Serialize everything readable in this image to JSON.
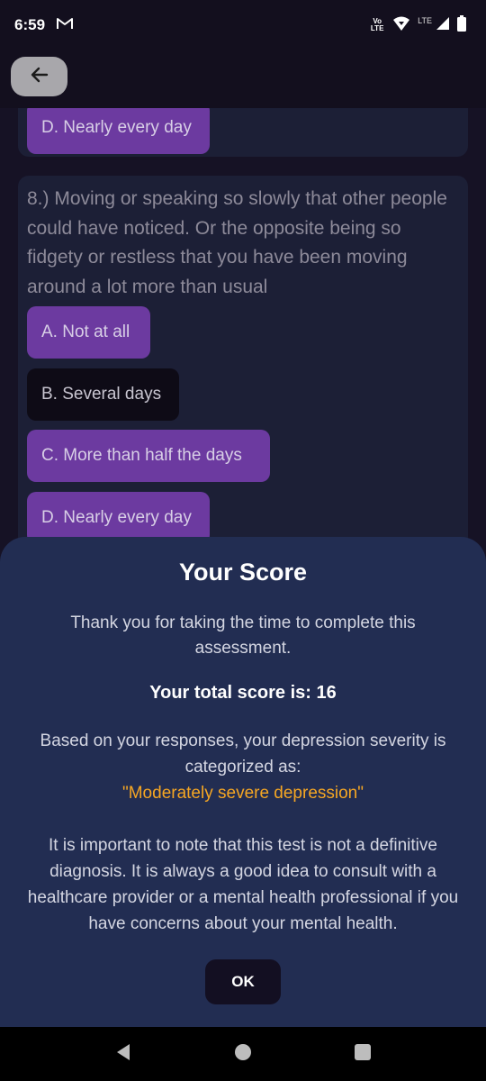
{
  "status_bar": {
    "time": "6:59",
    "mail_icon": "gmail-icon",
    "volte_top": "Vo",
    "volte_bottom": "LTE",
    "lte_label": "LTE"
  },
  "app_bar": {
    "back_icon": "arrow-left-icon"
  },
  "previous_card": {
    "selected_option": "D. Nearly every day"
  },
  "question8": {
    "text": "8.) Moving or speaking so slowly that other people could have noticed. Or the opposite being so fidgety or restless that you have been moving around a lot more than usual",
    "options": [
      "A. Not at all",
      "B. Several days",
      "C. More than half the days",
      "D. Nearly every day"
    ],
    "selected_index": 1
  },
  "dialog": {
    "title": "Your Score",
    "thanks": "Thank you for taking the time to complete this assessment.",
    "total": "Your total score is: 16",
    "based_on": "Based on your responses, your depression severity is categorized as:",
    "category": "\"Moderately severe depression\"",
    "note": "It is important to note that this test is not a definitive diagnosis. It is always a good idea to consult with a healthcare provider or a mental health professional if you have concerns about your mental health.",
    "ok_label": "OK"
  },
  "colors": {
    "option_bg": "#6c3aa0",
    "option_selected_bg": "#0e0b16",
    "dialog_bg": "#222d52",
    "category_text": "#f5a623"
  }
}
